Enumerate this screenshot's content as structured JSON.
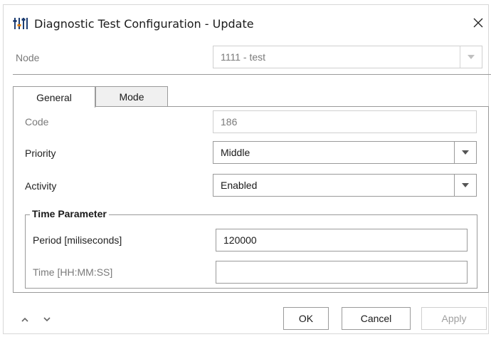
{
  "dialog": {
    "title": "Diagnostic Test Configuration - Update",
    "icon": "sliders-icon",
    "close_icon": "close-icon"
  },
  "node": {
    "label": "Node",
    "value": "1111 - test"
  },
  "tabs": [
    {
      "label": "General",
      "active": true
    },
    {
      "label": "Mode",
      "active": false
    }
  ],
  "general": {
    "code": {
      "label": "Code",
      "value": "186"
    },
    "priority": {
      "label": "Priority",
      "value": "Middle"
    },
    "activity": {
      "label": "Activity",
      "value": "Enabled"
    },
    "time_parameter": {
      "title": "Time Parameter",
      "period": {
        "label": "Period [miliseconds]",
        "value": "120000"
      },
      "time": {
        "label": "Time [HH:MM:SS]",
        "value": ""
      }
    }
  },
  "footer": {
    "up_icon": "chevron-up-icon",
    "down_icon": "chevron-down-icon",
    "ok_label": "OK",
    "cancel_label": "Cancel",
    "apply_label": "Apply"
  }
}
